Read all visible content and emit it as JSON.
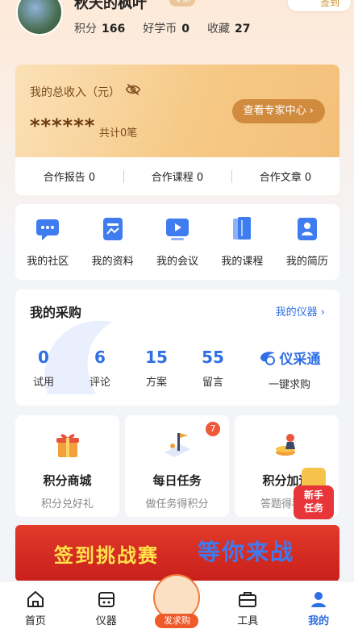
{
  "profile": {
    "nickname": "秋天的枫叶",
    "level": "专家",
    "signin_label": "签到",
    "stats": [
      {
        "label": "积分",
        "value": "166"
      },
      {
        "label": "好学币",
        "value": "0"
      },
      {
        "label": "收藏",
        "value": "27"
      }
    ]
  },
  "income": {
    "label": "我的总收入（元）",
    "amount": "******",
    "count": "共计0笔",
    "expert_center": "查看专家中心 ›",
    "coop": [
      "合作报告 0",
      "合作课程 0",
      "合作文章 0"
    ]
  },
  "features": [
    {
      "label": "我的社区",
      "icon": "community-icon"
    },
    {
      "label": "我的资料",
      "icon": "document-icon"
    },
    {
      "label": "我的会议",
      "icon": "meeting-icon"
    },
    {
      "label": "我的课程",
      "icon": "course-icon"
    },
    {
      "label": "我的简历",
      "icon": "resume-icon"
    }
  ],
  "purchase": {
    "title": "我的采购",
    "link": "我的仪器 ›",
    "stats": [
      {
        "value": "0",
        "label": "试用"
      },
      {
        "value": "6",
        "label": "评论"
      },
      {
        "value": "15",
        "label": "方案"
      },
      {
        "value": "55",
        "label": "留言"
      }
    ],
    "ycg_name": "仪采通",
    "ycg_sub": "一键求购"
  },
  "cards": [
    {
      "title": "积分商城",
      "sub": "积分兑好礼"
    },
    {
      "title": "每日任务",
      "sub": "做任务得积分",
      "badge": "7"
    },
    {
      "title": "积分加速",
      "sub": "答题得积分"
    }
  ],
  "float_task": "新手\n任务",
  "banner": {
    "left": "签到挑战赛",
    "right": "等你来战"
  },
  "tabs": [
    {
      "label": "首页"
    },
    {
      "label": "仪器"
    },
    {
      "label": "发求购"
    },
    {
      "label": "工具"
    },
    {
      "label": "我的"
    }
  ],
  "colors": {
    "accent": "#2f6fe4",
    "gold": "#d18b3f",
    "red": "#e8353a"
  }
}
